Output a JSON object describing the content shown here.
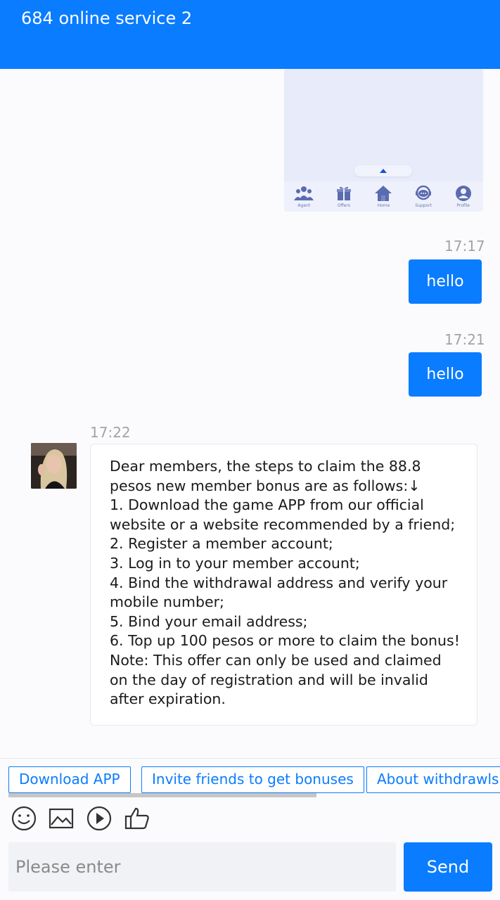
{
  "header": {
    "title": "684 online service 2"
  },
  "image_message": {
    "nav": [
      {
        "label": "Agent",
        "icon": "users-icon"
      },
      {
        "label": "Offers",
        "icon": "gift-icon"
      },
      {
        "label": "Home",
        "icon": "home-icon"
      },
      {
        "label": "Support",
        "icon": "support-icon"
      },
      {
        "label": "Profile",
        "icon": "profile-icon"
      }
    ]
  },
  "messages": [
    {
      "time": "17:17",
      "text": "hello",
      "direction": "out"
    },
    {
      "time": "17:21",
      "text": "hello",
      "direction": "out"
    },
    {
      "time": "17:22",
      "direction": "in",
      "text": "Dear members, the steps to claim the 88.8 pesos new member bonus are as follows:↓\n1. Download the game APP from our official website or a website recommended by a friend;\n2. Register a member account;\n3. Log in to your member account;\n4. Bind the withdrawal address and verify your mobile number;\n5. Bind your email address;\n6. Top up 100 pesos or more to claim the bonus! Note: This offer can only be used and claimed on the day of registration and will be invalid after expiration."
    }
  ],
  "quick_replies": [
    "Download APP",
    "Invite friends to get bonuses",
    "About withdrawls"
  ],
  "toolbar": {
    "icons": [
      "emoji-icon",
      "image-icon",
      "video-icon",
      "thumbs-up-icon"
    ]
  },
  "input": {
    "placeholder": "Please enter",
    "value": ""
  },
  "send_label": "Send",
  "colors": {
    "accent": "#0a7cff",
    "background": "#fbfbfd"
  }
}
